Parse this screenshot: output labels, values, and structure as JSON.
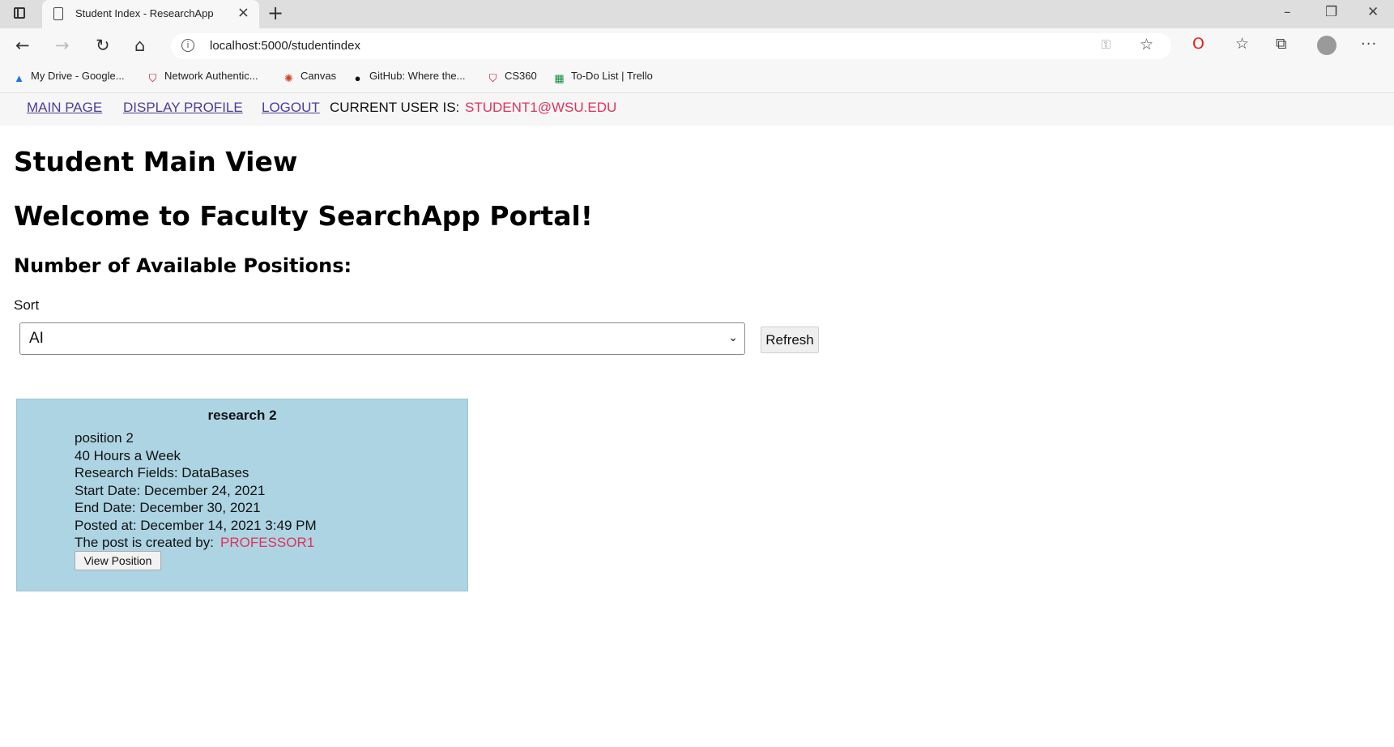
{
  "browser": {
    "tab_title": "Student Index - ResearchApp",
    "url": "localhost:5000/studentindex",
    "bookmarks": [
      {
        "label": "My Drive - Google...",
        "icon": "google-drive-icon"
      },
      {
        "label": "Network Authentic...",
        "icon": "wsu-shield-icon"
      },
      {
        "label": "Canvas",
        "icon": "canvas-icon"
      },
      {
        "label": "GitHub: Where the...",
        "icon": "github-icon"
      },
      {
        "label": "CS360",
        "icon": "wsu-shield-icon"
      },
      {
        "label": "To-Do List | Trello",
        "icon": "trello-icon"
      }
    ]
  },
  "nav": {
    "main_page": "MAIN PAGE",
    "display_profile": "DISPLAY PROFILE",
    "logout": "LOGOUT",
    "current_user_label": "CURRENT USER IS:",
    "current_user": "STUDENT1@WSU.EDU"
  },
  "page": {
    "heading": "Student Main View",
    "welcome": "Welcome to Faculty SearchApp Portal!",
    "positions_heading": "Number of Available Positions:",
    "sort_label": "Sort",
    "sort_value": "AI",
    "refresh_label": "Refresh"
  },
  "positions": [
    {
      "title": "research 2",
      "position": "position 2",
      "hours": "40 Hours a Week",
      "fields": "Research Fields: DataBases",
      "start": "Start Date: December 24, 2021",
      "end": "End Date: December 30, 2021",
      "posted": "Posted at: December 14, 2021 3:49 PM",
      "created_by_label": "The post is created by:",
      "created_by": "PROFESSOR1",
      "view_label": "View Position"
    }
  ],
  "colors": {
    "accent_user": "#e0335a",
    "card_bg": "#add4e3",
    "link": "#4b3f9a"
  }
}
